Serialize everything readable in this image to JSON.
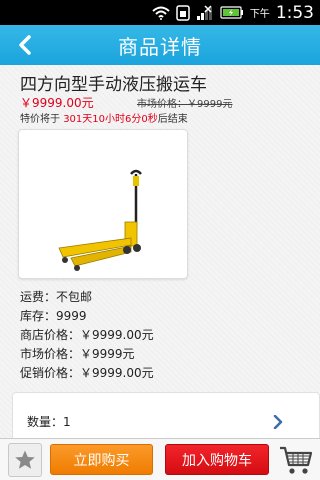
{
  "status_bar": {
    "ampm": "下午",
    "time": "1:53",
    "icons": [
      "wifi-icon",
      "sim-icon",
      "signal-icon",
      "battery-icon"
    ]
  },
  "header": {
    "title": "商品详情",
    "back_icon": "chevron-left-icon"
  },
  "product": {
    "title": "四方向型手动液压搬运车",
    "price": "￥9999.00元",
    "market_price": "市场价格：￥9999元",
    "countdown_prefix": "特价将于",
    "countdown_time": "301天10小时6分0秒",
    "countdown_suffix": "后结束",
    "image_icon": "pallet-jack-image"
  },
  "info": {
    "shipping": "运费：不包邮",
    "stock": "库存：9999",
    "shop_price": "商店价格：￥9999.00元",
    "market_price": "市场价格：￥9999元",
    "promo_price": "促销价格：￥9999.00元"
  },
  "quantity": {
    "label": "数量：1",
    "arrow_icon": "chevron-right-icon"
  },
  "bottom_bar": {
    "fav_icon": "star-icon",
    "buy_now": "立即购买",
    "add_to_cart": "加入购物车",
    "cart_icon": "shopping-cart-icon"
  },
  "colors": {
    "header": "#1aa4dc",
    "price_red": "#e0001b",
    "buy_orange": "#f07c00",
    "cart_red": "#d40d12"
  }
}
